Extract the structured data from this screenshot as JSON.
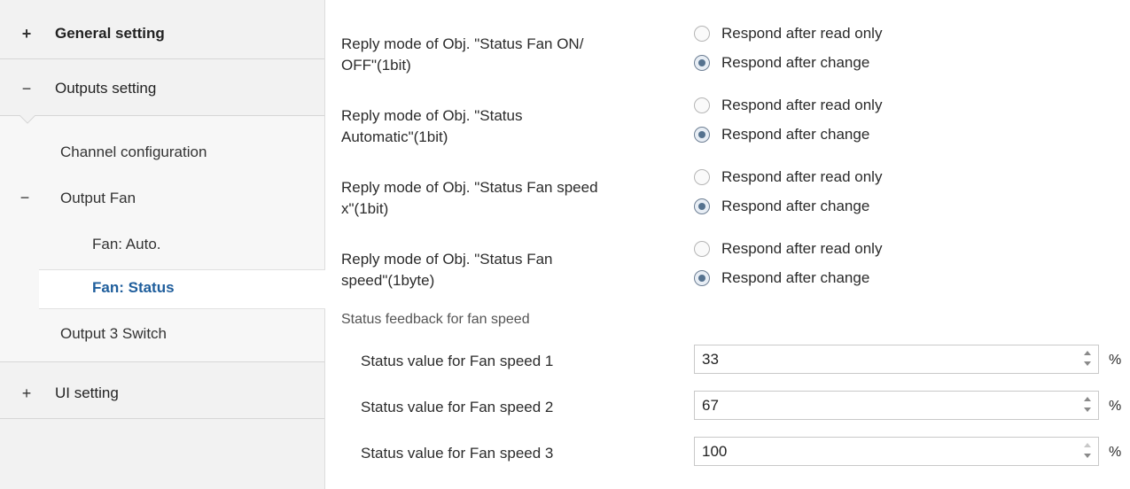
{
  "sidebar": {
    "general_setting": {
      "sign": "+",
      "label": "General setting"
    },
    "outputs_setting": {
      "sign": "−",
      "label": "Outputs setting"
    },
    "channel_configuration": "Channel configuration",
    "output_fan": {
      "sign": "−",
      "label": "Output Fan"
    },
    "fan_auto": "Fan: Auto.",
    "fan_status": "Fan: Status",
    "output_3_switch": "Output 3 Switch",
    "ui_setting": {
      "sign": "+",
      "label": "UI setting"
    }
  },
  "params": [
    {
      "label_line1": "Reply mode of Obj. \"Status Fan ON/",
      "label_line2": "OFF\"(1bit)",
      "option_read": "Respond after read only",
      "option_change": "Respond after change",
      "selected": "change"
    },
    {
      "label_line1": "Reply mode of Obj. \"Status",
      "label_line2": "Automatic\"(1bit)",
      "option_read": "Respond after read only",
      "option_change": "Respond after change",
      "selected": "change"
    },
    {
      "label_line1": "Reply mode of Obj. \"Status Fan speed",
      "label_line2": "x\"(1bit)",
      "option_read": "Respond after read only",
      "option_change": "Respond after change",
      "selected": "change"
    },
    {
      "label_line1": "Reply mode of Obj. \"Status Fan",
      "label_line2": "speed\"(1byte)",
      "option_read": "Respond after read only",
      "option_change": "Respond after change",
      "selected": "change"
    }
  ],
  "feedback": {
    "title": "Status feedback for fan speed",
    "fields": [
      {
        "label": "Status value for Fan speed 1",
        "value": "33",
        "unit": "%"
      },
      {
        "label": "Status value for Fan speed 2",
        "value": "67",
        "unit": "%"
      },
      {
        "label": "Status value for Fan speed 3",
        "value": "100",
        "unit": "%"
      }
    ]
  }
}
